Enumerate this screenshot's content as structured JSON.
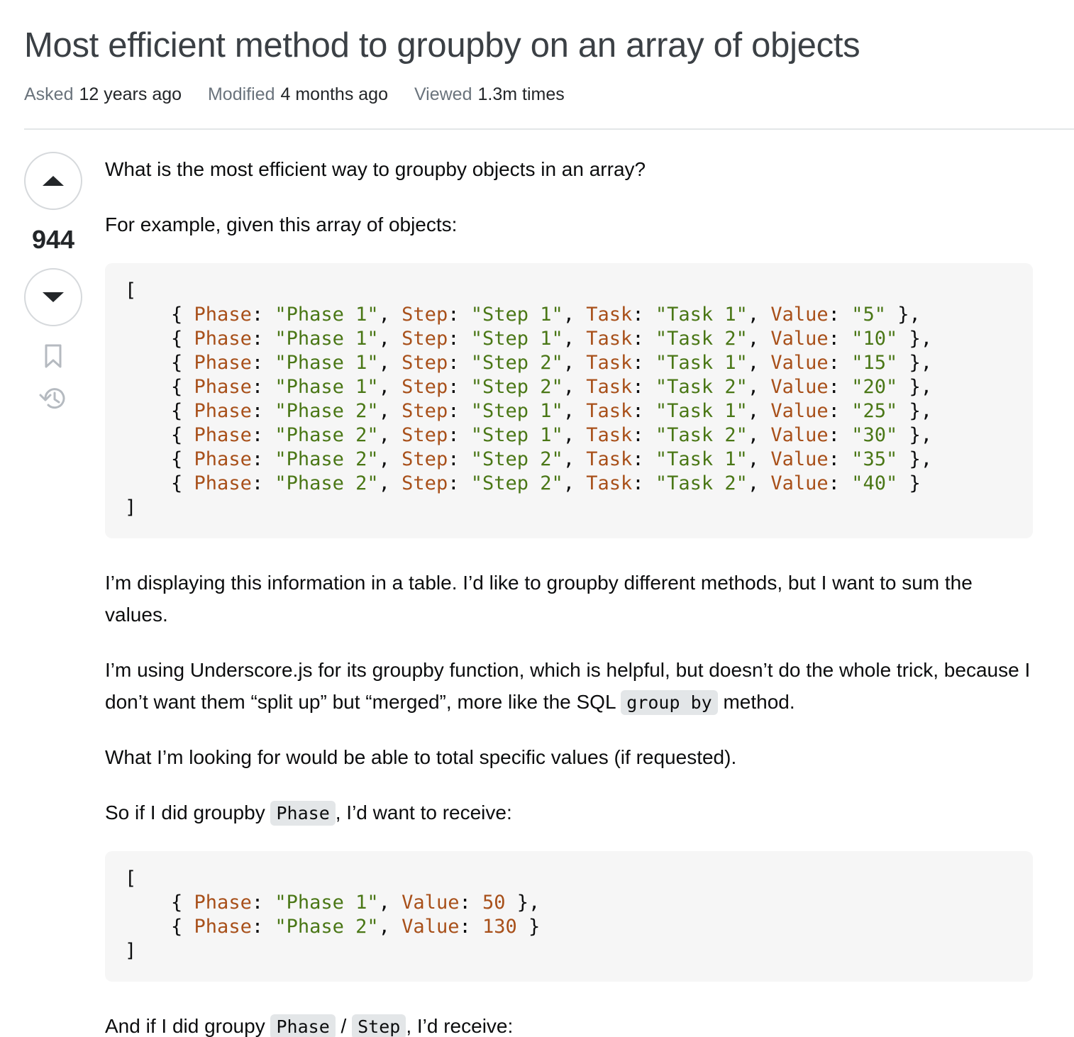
{
  "question": {
    "title": "Most efficient method to groupby on an array of objects",
    "meta": [
      {
        "key": "Asked",
        "value": "12 years ago"
      },
      {
        "key": "Modified",
        "value": "4 months ago"
      },
      {
        "key": "Viewed",
        "value": "1.3m times"
      }
    ],
    "votes": "944",
    "icons": {
      "upvote": "caret-up-icon",
      "downvote": "caret-down-icon",
      "bookmark": "bookmark-icon",
      "history": "history-icon"
    }
  },
  "body": {
    "p1": "What is the most efficient way to groupby objects in an array?",
    "p2": "For example, given this array of objects:",
    "code1": {
      "open": "[",
      "close": "]",
      "rows": [
        {
          "Phase": "\"Phase 1\"",
          "Step": "\"Step 1\"",
          "Task": "\"Task 1\"",
          "Value": "\"5\"",
          "end": " },"
        },
        {
          "Phase": "\"Phase 1\"",
          "Step": "\"Step 1\"",
          "Task": "\"Task 2\"",
          "Value": "\"10\"",
          "end": " },"
        },
        {
          "Phase": "\"Phase 1\"",
          "Step": "\"Step 2\"",
          "Task": "\"Task 1\"",
          "Value": "\"15\"",
          "end": " },"
        },
        {
          "Phase": "\"Phase 1\"",
          "Step": "\"Step 2\"",
          "Task": "\"Task 2\"",
          "Value": "\"20\"",
          "end": " },"
        },
        {
          "Phase": "\"Phase 2\"",
          "Step": "\"Step 1\"",
          "Task": "\"Task 1\"",
          "Value": "\"25\"",
          "end": " },"
        },
        {
          "Phase": "\"Phase 2\"",
          "Step": "\"Step 1\"",
          "Task": "\"Task 2\"",
          "Value": "\"30\"",
          "end": " },"
        },
        {
          "Phase": "\"Phase 2\"",
          "Step": "\"Step 2\"",
          "Task": "\"Task 1\"",
          "Value": "\"35\"",
          "end": " },"
        },
        {
          "Phase": "\"Phase 2\"",
          "Step": "\"Step 2\"",
          "Task": "\"Task 2\"",
          "Value": "\"40\"",
          "end": " }"
        }
      ]
    },
    "p3": "I’m displaying this information in a table. I’d like to groupby different methods, but I want to sum the values.",
    "p4_before": "I’m using Underscore.js for its groupby function, which is helpful, but doesn’t do the whole trick, because I don’t want them “split up” but “merged”, more like the SQL ",
    "p4_code": "group by",
    "p4_after": " method.",
    "p5": "What I’m looking for would be able to total specific values (if requested).",
    "p6_before": "So if I did groupby ",
    "p6_code": "Phase",
    "p6_after": ", I’d want to receive:",
    "code2": {
      "open": "[",
      "close": "]",
      "rows": [
        {
          "Phase": "\"Phase 1\"",
          "Value": "50",
          "end": " },"
        },
        {
          "Phase": "\"Phase 2\"",
          "Value": "130",
          "end": " }"
        }
      ]
    },
    "p7_before": "And if I did groupy ",
    "p7_code1": "Phase",
    "p7_sep": " / ",
    "p7_code2": "Step",
    "p7_after": ", I’d receive:"
  }
}
